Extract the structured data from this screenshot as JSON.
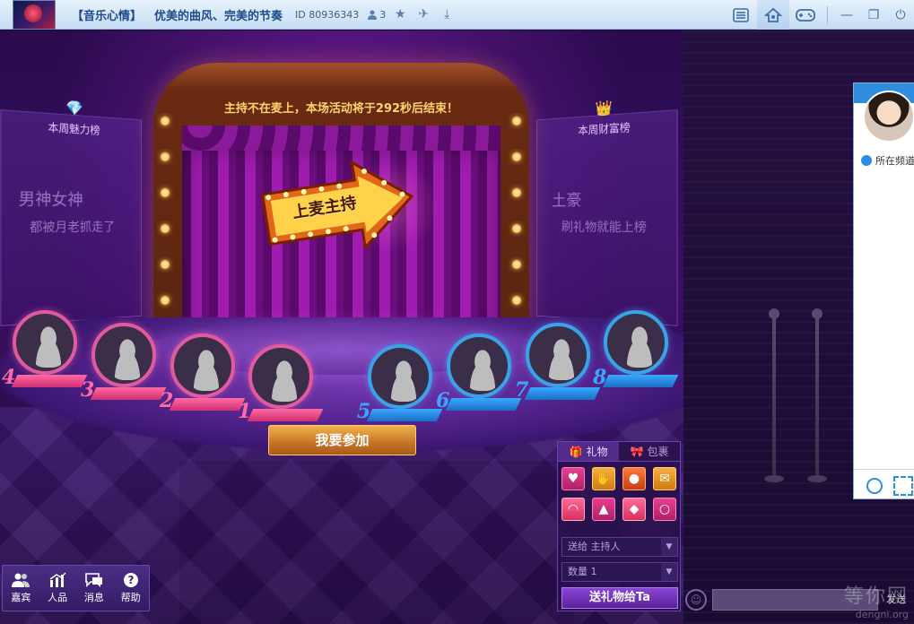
{
  "titlebar": {
    "category": "【音乐心情】",
    "room_name": "优美的曲风、完美的节奏",
    "room_id": "ID 80936343",
    "user_count": "3"
  },
  "stage": {
    "notice": "主持不在麦上，本场活动将于292秒后结束！",
    "mic_button_label": "上麦主持",
    "join_button_label": "我要参加",
    "left_board": {
      "title": "本周魅力榜",
      "line1": "男神女神",
      "line2": "都被月老抓走了"
    },
    "right_board": {
      "title": "本周财富榜",
      "line1": "土豪",
      "line2": "刷礼物就能上榜"
    },
    "seats": [
      {
        "num": "4",
        "gender": "female"
      },
      {
        "num": "3",
        "gender": "female"
      },
      {
        "num": "2",
        "gender": "female"
      },
      {
        "num": "1",
        "gender": "female"
      },
      {
        "num": "5",
        "gender": "male"
      },
      {
        "num": "6",
        "gender": "male"
      },
      {
        "num": "7",
        "gender": "male"
      },
      {
        "num": "8",
        "gender": "male"
      }
    ],
    "colors": {
      "female": "#e05aa0",
      "male": "#3aa2e6"
    }
  },
  "toolbar": {
    "items": [
      {
        "label": "嘉宾",
        "icon": "guests-icon"
      },
      {
        "label": "人品",
        "icon": "chart-icon"
      },
      {
        "label": "消息",
        "icon": "message-icon"
      },
      {
        "label": "帮助",
        "icon": "help-icon"
      }
    ]
  },
  "gift_panel": {
    "tab_gifts": "礼物",
    "tab_bag": "包裹",
    "gifts": [
      {
        "icon": "heart-gift-icon",
        "glyph": "♥"
      },
      {
        "icon": "clap-gift-icon",
        "glyph": "✋"
      },
      {
        "icon": "lollipop-gift-icon",
        "glyph": "●"
      },
      {
        "icon": "love-letter-gift-icon",
        "glyph": "✉"
      },
      {
        "icon": "lips-gift-icon",
        "glyph": "◠"
      },
      {
        "icon": "cake-gift-icon",
        "glyph": "▲"
      },
      {
        "icon": "candy-gift-icon",
        "glyph": "◆"
      },
      {
        "icon": "ring-gift-icon",
        "glyph": "○"
      }
    ],
    "send_to": "送给 主持人",
    "quantity": "数量 1",
    "send_label": "送礼物给Ta"
  },
  "chat": {
    "location_label": "所在频道",
    "send_label": "发送"
  },
  "watermark": {
    "cn": "等你网",
    "url": "dengni.org"
  }
}
